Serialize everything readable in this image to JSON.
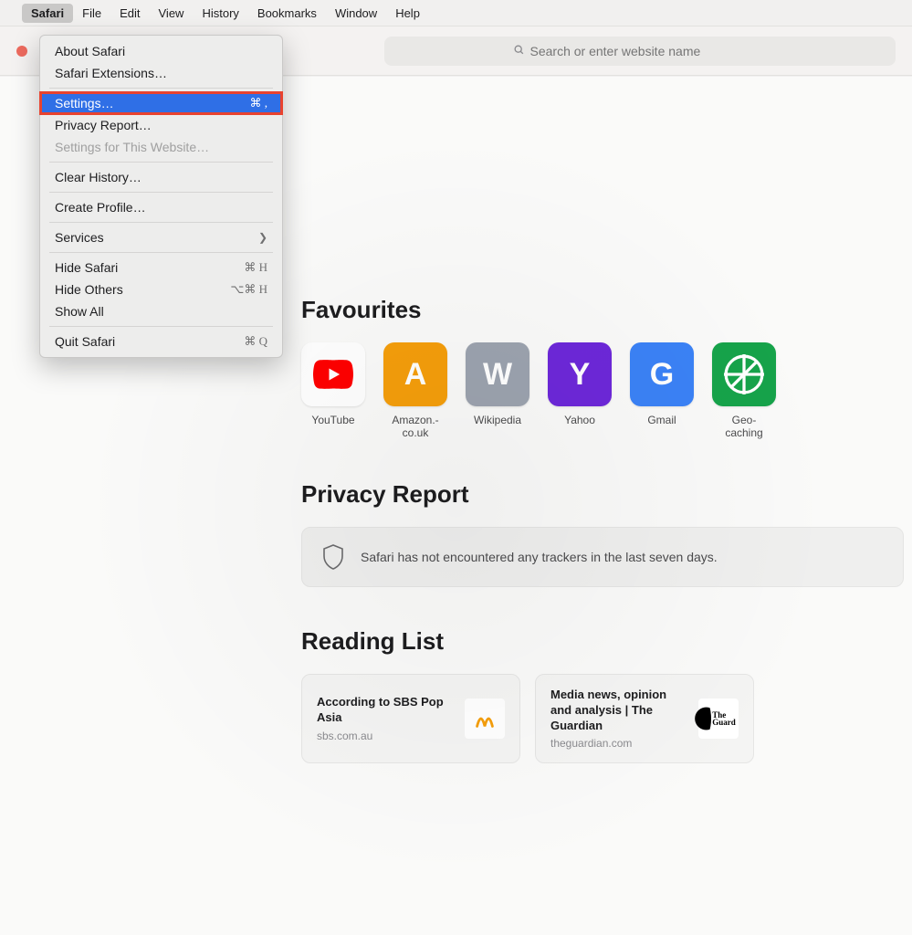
{
  "menubar": {
    "items": [
      "Safari",
      "File",
      "Edit",
      "View",
      "History",
      "Bookmarks",
      "Window",
      "Help"
    ],
    "active": "Safari"
  },
  "omnibox": {
    "placeholder": "Search or enter website name"
  },
  "dropdown": {
    "about": "About Safari",
    "extensions": "Safari Extensions…",
    "settings": "Settings…",
    "settings_shortcut": "⌘ ,",
    "privacy_report": "Privacy Report…",
    "site_settings": "Settings for This Website…",
    "clear_history": "Clear History…",
    "create_profile": "Create Profile…",
    "services": "Services",
    "hide_safari": "Hide Safari",
    "hide_safari_short": "⌘ H",
    "hide_others": "Hide Others",
    "hide_others_short": "⌥⌘ H",
    "show_all": "Show All",
    "quit": "Quit Safari",
    "quit_short": "⌘ Q"
  },
  "sections": {
    "favourites_title": "Favourites",
    "privacy_title": "Privacy Report",
    "reading_title": "Reading List"
  },
  "favourites": [
    {
      "label": "YouTube"
    },
    {
      "label": "Amazon.co.uk",
      "letter": "A"
    },
    {
      "label": "Wikipedia",
      "letter": "W"
    },
    {
      "label": "Yahoo",
      "letter": "Y"
    },
    {
      "label": "Gmail",
      "letter": "G"
    },
    {
      "label": "Geocaching"
    }
  ],
  "privacy_message": "Safari has not encountered any trackers in the last seven days.",
  "reading_list": [
    {
      "title": "According to SBS Pop Asia",
      "domain": "sbs.com.au"
    },
    {
      "title": "Media news, opinion and analysis | The Guardian",
      "domain": "theguardian.com"
    }
  ]
}
